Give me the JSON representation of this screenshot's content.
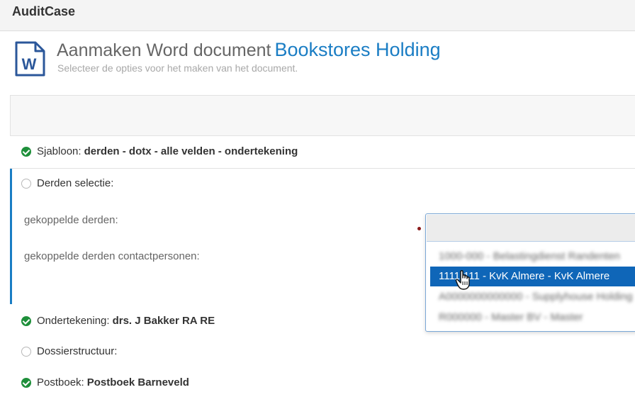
{
  "app": {
    "title": "AuditCase"
  },
  "header": {
    "title": "Aanmaken Word document",
    "client": "Bookstores Holding",
    "subtitle": "Selecteer de opties voor het maken van het document.",
    "icon": "word-document-icon"
  },
  "steps": {
    "sjabloon": {
      "label": "Sjabloon:",
      "value": "derden - dotx - alle velden - ondertekening",
      "status": "complete"
    },
    "derden_selectie": {
      "label": "Derden selectie:",
      "status": "pending",
      "fields": {
        "gekoppelde_derden": {
          "label": "gekoppelde derden:"
        },
        "contactpersonen": {
          "label": "gekoppelde derden contactpersonen:"
        }
      }
    },
    "ondertekening": {
      "label": "Ondertekening:",
      "value": "drs. J Bakker RA RE",
      "status": "complete"
    },
    "dossierstructuur": {
      "label": "Dossierstructuur:",
      "status": "pending"
    },
    "postboek": {
      "label": "Postboek:",
      "value": "Postboek Barneveld",
      "status": "complete"
    }
  },
  "dropdown": {
    "search_value": "",
    "options": [
      {
        "text": "1000-000 - Belastingdienst Randenten",
        "blurred": true,
        "selected": false
      },
      {
        "text": "1111-111 - KvK Almere - KvK Almere",
        "blurred": false,
        "selected": true
      },
      {
        "text": "A0000000000000 - Supplyhouse Holding",
        "blurred": true,
        "selected": false
      },
      {
        "text": "R000000 - Master BV - Master",
        "blurred": true,
        "selected": false
      }
    ]
  },
  "colors": {
    "accent": "#1a7dc4",
    "success": "#1e8f3a",
    "selected": "#0f66b8"
  }
}
